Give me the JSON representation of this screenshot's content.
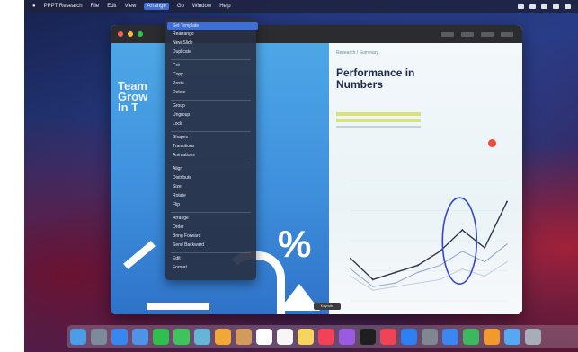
{
  "menubar": {
    "app_name": "PPPT Research",
    "items": [
      "File",
      "Edit",
      "View",
      "Arrange",
      "Go",
      "Window",
      "Help"
    ],
    "active_item": "Arrange"
  },
  "dropdown": {
    "items": [
      "Set Template",
      "Rearrange",
      "New Slide",
      "Duplicate",
      "Cut",
      "Copy",
      "Paste",
      "Delete",
      "Group",
      "Ungroup",
      "Lock",
      "Shapes",
      "Transitions",
      "Animations",
      "Align",
      "Distribute",
      "Size",
      "Rotate",
      "Flip",
      "Arrange",
      "Order",
      "Bring Forward",
      "Send Backward",
      "Edit",
      "Format"
    ]
  },
  "slide_left": {
    "big_text": [
      "Team",
      "Grow",
      "In T"
    ],
    "percent_symbol": "%"
  },
  "slide_right": {
    "breadcrumb": "Research / Summary",
    "heading": "Performance in Numbers"
  },
  "chart_data": {
    "type": "line",
    "x": [
      1,
      2,
      3,
      4,
      5,
      6,
      7,
      8
    ],
    "series": [
      {
        "values": [
          12,
          6,
          8,
          10,
          14,
          20,
          15,
          28
        ],
        "color": "#30364f"
      },
      {
        "values": [
          9,
          4,
          5,
          8,
          10,
          14,
          11,
          16
        ],
        "color": "#8fa3c9"
      },
      {
        "values": [
          7,
          3,
          4,
          5,
          6,
          9,
          7,
          11
        ],
        "color": "#c1cee0"
      }
    ],
    "ylim": [
      0,
      34
    ],
    "grid": true
  },
  "tooltip": "Keynote",
  "dock": {
    "icons": [
      "finder-icon",
      "launchpad-icon",
      "safari-icon",
      "mail-icon",
      "facetime-icon",
      "messages-icon",
      "maps-icon",
      "photos-icon",
      "contacts-icon",
      "calendar-icon",
      "reminders-icon",
      "notes-icon",
      "music-icon",
      "podcasts-icon",
      "tv-icon",
      "news-icon",
      "appstore-icon",
      "settings-icon",
      "keynote-icon",
      "numbers-icon",
      "pages-icon",
      "folder-icon",
      "trash-icon"
    ],
    "colors": [
      "#4d9ce6",
      "#7d8a9c",
      "#3a86ef",
      "#4f92e6",
      "#2fbf4f",
      "#3fc35c",
      "#67b5d6",
      "#f1a838",
      "#d29a5c",
      "#ffffff",
      "#f6f6f6",
      "#f5d462",
      "#f0435a",
      "#9a5be0",
      "#1f1f1f",
      "#ef4456",
      "#2f7ff0",
      "#7e8792",
      "#3e86ef",
      "#3cb85e",
      "#f39a2e",
      "#57a8ee",
      "#a7aeb8"
    ]
  }
}
